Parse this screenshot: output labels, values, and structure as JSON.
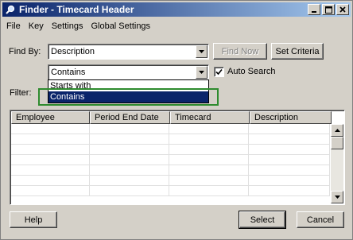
{
  "window": {
    "title": "Finder - Timecard Header"
  },
  "title_buttons": {
    "minimize": "_",
    "maximize": "□",
    "close": "×"
  },
  "menu": [
    "File",
    "Key",
    "Settings",
    "Global Settings"
  ],
  "find_by": {
    "label": "Find By:",
    "value": "Description"
  },
  "match_mode": {
    "value": "Contains"
  },
  "buttons": {
    "find_now": "Find Now",
    "set_criteria": "Set Criteria",
    "help": "Help",
    "select": "Select",
    "cancel": "Cancel"
  },
  "auto_search": {
    "label": "Auto Search",
    "checked": true
  },
  "filter": {
    "label": "Filter:"
  },
  "match_options": [
    "Starts with",
    "Contains"
  ],
  "grid": {
    "columns": [
      "Employee",
      "Period End Date",
      "Timecard",
      "Description"
    ]
  },
  "icons": {
    "app": "magnifier-icon",
    "dropdown": "chevron-down-icon",
    "check": "checkmark-icon"
  }
}
